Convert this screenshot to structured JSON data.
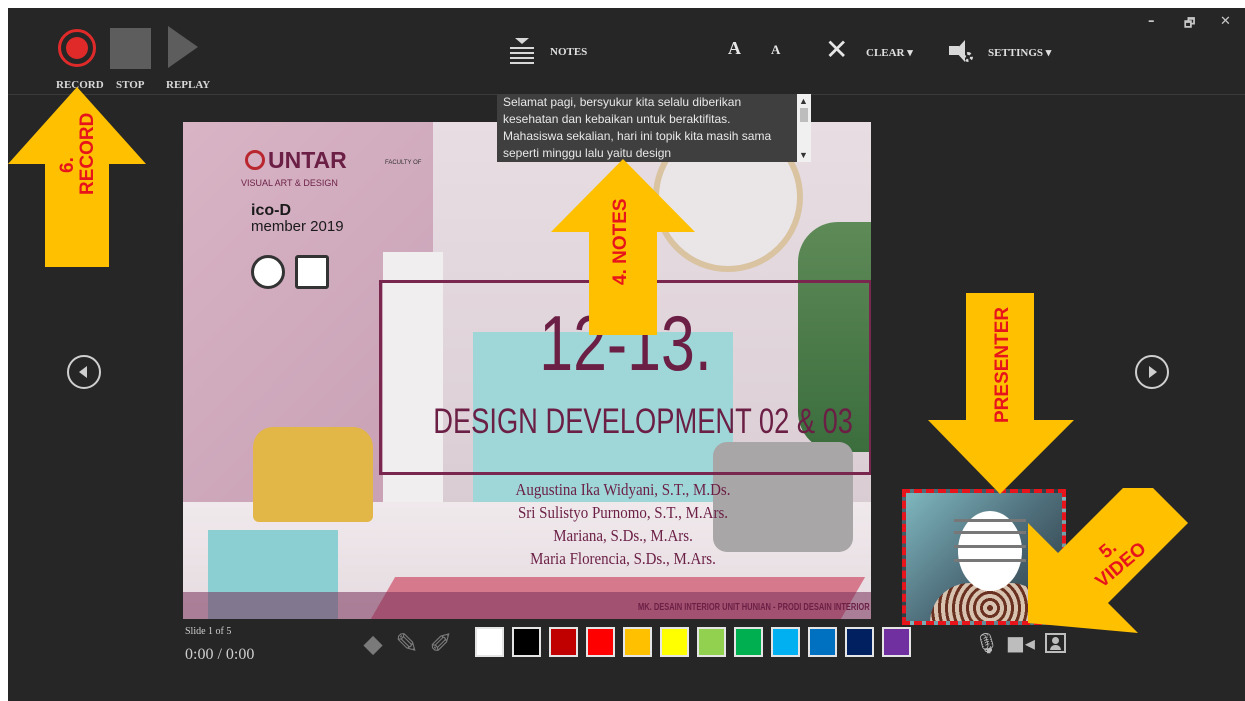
{
  "window": {
    "minimize_glyph": "–",
    "maximize_glyph": "🗗",
    "close_glyph": "✕"
  },
  "toolbar": {
    "record_label": "RECORD",
    "stop_label": "STOP",
    "replay_label": "REPLAY",
    "notes_label": "NOTES",
    "font_increase": "A",
    "font_decrease": "A",
    "clear_label": "CLEAR ▾",
    "settings_label": "SETTINGS ▾",
    "accent_color": "#e02a2a"
  },
  "notes": {
    "text": "Selamat pagi, bersyukur kita selalu diberikan kesehatan dan kebaikan untuk beraktifitas. Mahasiswa sekalian, hari ini topik kita masih sama seperti minggu lalu yaitu design"
  },
  "slide": {
    "logo_name": "UNTAR",
    "logo_faculty": "FACULTY OF",
    "logo_faculty_sub": "VISUAL ART & DESIGN",
    "ico_d": "ico-D",
    "member": "member 2019",
    "title_number": "12-13.",
    "title_subtitle": "DESIGN DEVELOPMENT 02 & 03",
    "authors": [
      "Augustina Ika Widyani, S.T., M.Ds.",
      "Sri Sulistyo Purnomo, S.T., M.Ars.",
      "Mariana, S.Ds., M.Ars.",
      "Maria Florencia, S.Ds., M.Ars."
    ],
    "footer": "MK. DESAIN INTERIOR UNIT HUNIAN - PRODI DESAIN INTERIOR"
  },
  "status": {
    "slide_count": "Slide 1 of 5",
    "timer": "0:00 / 0:00"
  },
  "pen_colors": [
    "#ffffff",
    "#000000",
    "#c00000",
    "#ff0000",
    "#ffc000",
    "#ffff00",
    "#92d050",
    "#00b050",
    "#00b0f0",
    "#0070c0",
    "#002060",
    "#7030a0"
  ],
  "annotations": {
    "record": "6.\nRECORD",
    "notes": "4. NOTES",
    "presenter": "PRESENTER",
    "video": "5.\nVIDEO",
    "arrow_color": "#ffc000",
    "label_color": "#e8141b"
  }
}
